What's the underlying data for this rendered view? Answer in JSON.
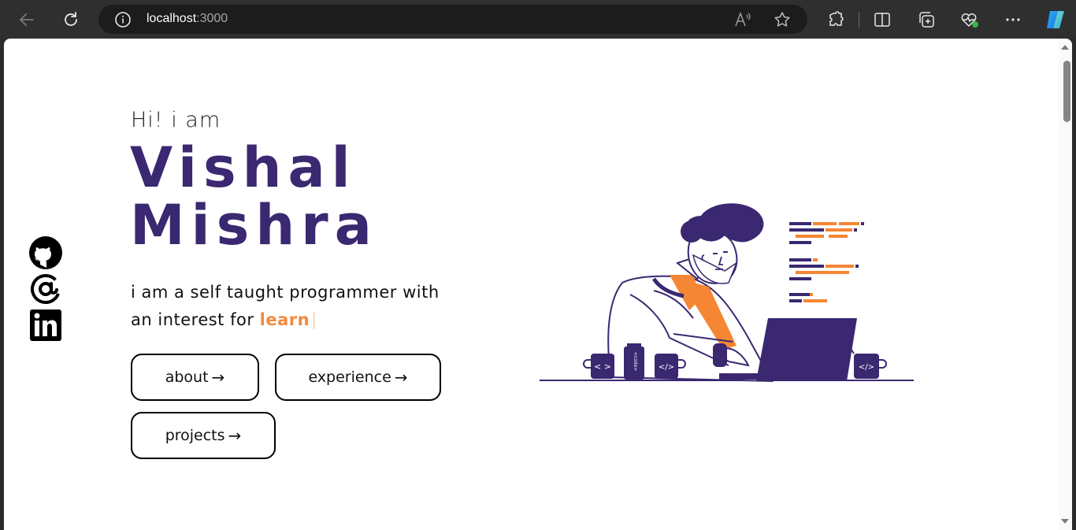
{
  "browser": {
    "url_host": "localhost",
    "url_port": ":3000",
    "icons": {
      "back": "back-arrow-icon",
      "refresh": "refresh-icon",
      "info": "info-icon",
      "read_aloud": "read-aloud-icon",
      "favorite": "star-icon",
      "extensions": "puzzle-icon",
      "split": "split-screen-icon",
      "collections": "collections-icon",
      "health": "browser-health-icon",
      "more": "more-icon",
      "copilot": "copilot-icon"
    }
  },
  "hero": {
    "greeting": "Hi! i am",
    "first_name": "Vishal",
    "last_name": "Mishra",
    "bio_line1": "i am a self taught programmer with",
    "bio_line2_prefix": "an interest for",
    "bio_highlight": "learn",
    "bio_caret": "|"
  },
  "buttons": {
    "about": "about",
    "experience": "experience",
    "projects": "projects",
    "arrow": "→"
  },
  "socials": [
    "github-icon",
    "at-sign-icon",
    "linkedin-icon"
  ],
  "colors": {
    "name": "#3a2871",
    "accent": "#f4883e",
    "illustration_purple": "#3a2871",
    "illustration_orange": "#f58634"
  }
}
